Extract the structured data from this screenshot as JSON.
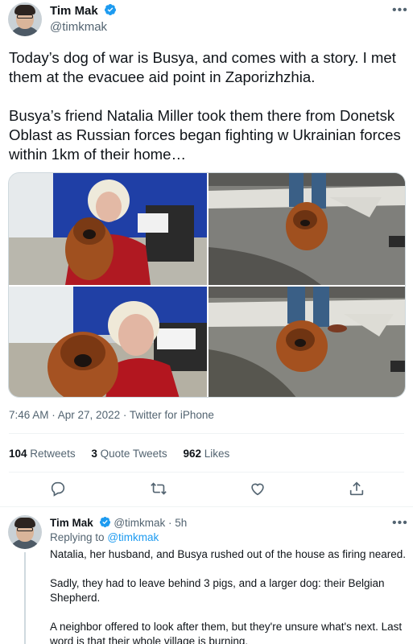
{
  "main_tweet": {
    "author_name": "Tim Mak",
    "author_handle": "@timkmak",
    "more_label": "•••",
    "paragraphs": [
      "Today’s dog of war is Busya, and comes with a story. I met them at the evacuee aid point in Zaporizhzhia.",
      "Busya’s friend Natalia Miller took them there from Donetsk Oblast as Russian forces began fighting w Ukrainian forces within 1km of their home…"
    ],
    "timestamp": "7:46 AM · Apr 27, 2022 · Twitter for iPhone",
    "retweets_count": "104",
    "retweets_label": "Retweets",
    "quotes_count": "3",
    "quotes_label": "Quote Tweets",
    "likes_count": "962",
    "likes_label": "Likes",
    "icons": [
      "reply-icon",
      "retweet-icon",
      "like-icon",
      "share-icon"
    ]
  },
  "reply_tweet": {
    "author_name": "Tim Mak",
    "author_handle": "@timkmak",
    "time_ago": "· 5h",
    "more_label": "•••",
    "replying_prefix": "Replying to",
    "replying_to": "@timkmak",
    "paragraphs": [
      "Natalia, her husband, and Busya rushed out of the house as firing neared.",
      "Sadly, they had to leave behind 3 pigs, and a larger dog: their Belgian Shepherd.",
      "A neighbor offered to look after them, but they're unsure what's next. Last word is that their whole village is burning."
    ]
  },
  "colors": {
    "accent": "#1d9bf0",
    "text": "#0f1419",
    "muted": "#536471",
    "border": "#eff3f4"
  }
}
